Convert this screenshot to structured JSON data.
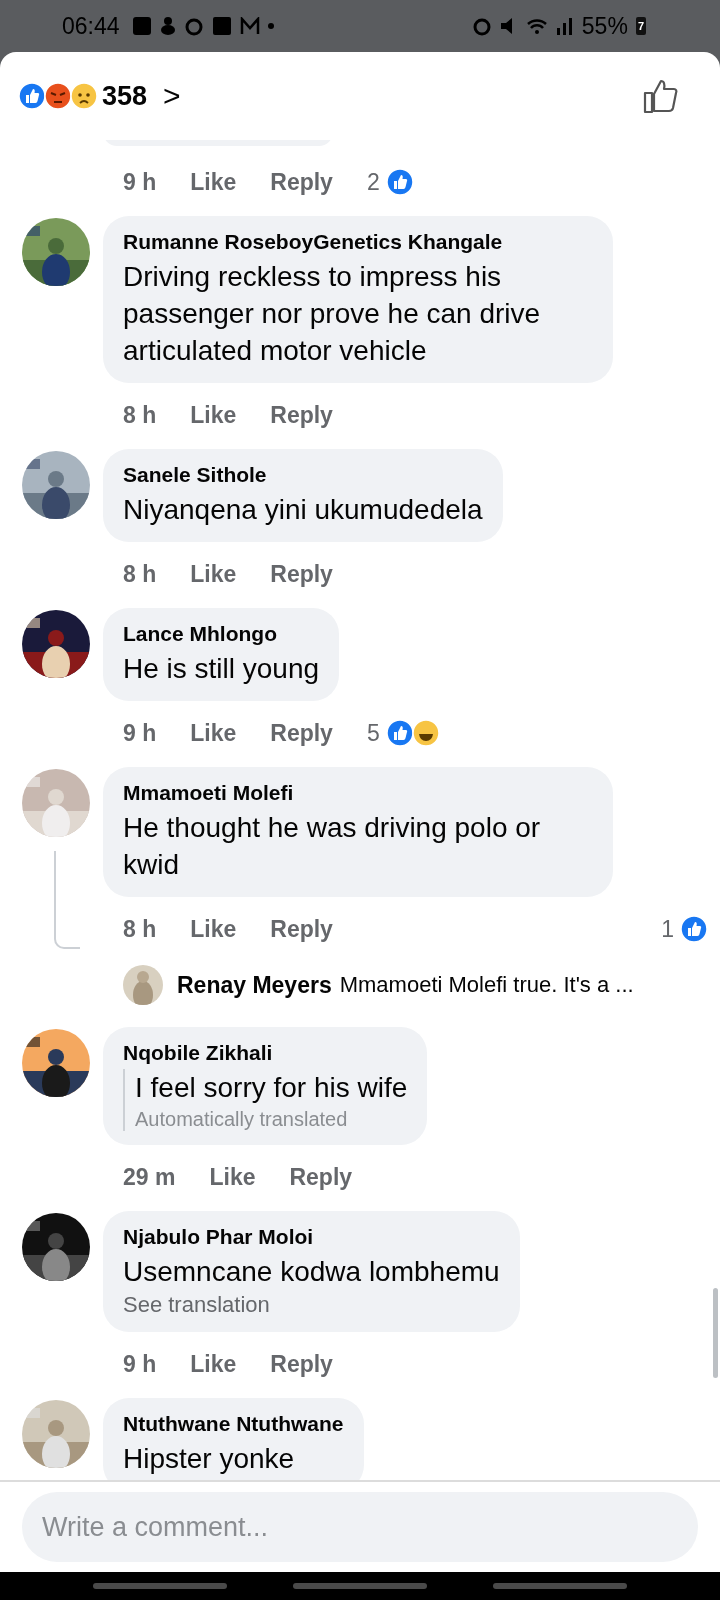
{
  "status_bar": {
    "time": "06:44",
    "battery": "55%",
    "battery_badge": "7"
  },
  "header": {
    "reactions": [
      {
        "kind": "like"
      },
      {
        "kind": "angry"
      },
      {
        "kind": "sad"
      }
    ],
    "count": "358",
    "chevron": ">"
  },
  "comments": [
    {
      "time": "9 h",
      "like": "Like",
      "reply": "Reply",
      "reaction_count": "2",
      "reactions": [
        {
          "kind": "like"
        }
      ]
    },
    {
      "author": "Rumanne RoseboyGenetics Khangale",
      "text": "Driving reckless to impress his passenger nor prove he can drive articulated motor vehicle",
      "time": "8 h",
      "like": "Like",
      "reply": "Reply"
    },
    {
      "author": "Sanele Sithole",
      "text": "Niyanqena yini ukumudedela",
      "time": "8 h",
      "like": "Like",
      "reply": "Reply"
    },
    {
      "author": "Lance Mhlongo",
      "text": "He is still young",
      "time": "9 h",
      "like": "Like",
      "reply": "Reply",
      "reaction_count": "5",
      "reactions": [
        {
          "kind": "like"
        },
        {
          "kind": "haha"
        }
      ]
    },
    {
      "author": "Mmamoeti Molefi",
      "text": "He thought he was driving polo or kwid",
      "time": "8 h",
      "like": "Like",
      "reply": "Reply",
      "reaction_count": "1",
      "reactions": [
        {
          "kind": "like"
        }
      ],
      "replies": [
        {
          "author": "Renay Meyers",
          "text": "Mmamoeti Molefi true. It's a ..."
        }
      ]
    },
    {
      "author": "Nqobile Zikhali",
      "text": "I feel sorry for his wife",
      "note": {
        "kind": "auto",
        "text": "Automatically translated"
      },
      "time": "29 m",
      "like": "Like",
      "reply": "Reply"
    },
    {
      "author": "Njabulo Phar Moloi",
      "text": "Usemncane kodwa lombhemu",
      "note": {
        "kind": "link",
        "text": "See translation"
      },
      "time": "9 h",
      "like": "Like",
      "reply": "Reply"
    },
    {
      "author": "Ntuthwane Ntuthwane",
      "text": "Hipster yonke"
    }
  ],
  "composer": {
    "placeholder": "Write a comment..."
  }
}
